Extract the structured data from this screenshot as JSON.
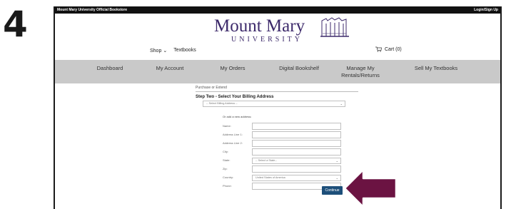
{
  "tutorial_step": "4",
  "topbar": {
    "store_name": "Mount Mary University Official Bookstore",
    "login": "Login/Sign Up"
  },
  "logo": {
    "wordmark": "Mount Mary",
    "subword": "UNIVERSITY",
    "color": "#3d2a6b"
  },
  "header": {
    "shop_label": "Shop",
    "textbooks_label": "Textbooks",
    "cart_label": "Cart (0)"
  },
  "nav": {
    "items": [
      "Dashboard",
      "My Account",
      "My Orders",
      "Digital Bookshelf",
      "Manage My Rentals/Returns",
      "Sell My Textbooks"
    ]
  },
  "form": {
    "breadcrumb": "Purchase or Extend",
    "heading": "Step Two - Select Your Billing Address",
    "billing_select": "-- Select Billing Address --",
    "or_add": "Or add a new address:",
    "fields": {
      "name": "Name:",
      "address1": "Address Line 1:",
      "address2": "Address Line 2:",
      "city": "City:",
      "state": "State:",
      "zip": "Zip:",
      "country": "Country:",
      "phone": "Phone:"
    },
    "state_value": "-- Select a State--",
    "country_value": "United States of America",
    "continue_label": "Continue"
  },
  "colors": {
    "accent": "#1d4f7a",
    "arrow": "#6b1342",
    "nav_bg": "#c9c9c9"
  }
}
